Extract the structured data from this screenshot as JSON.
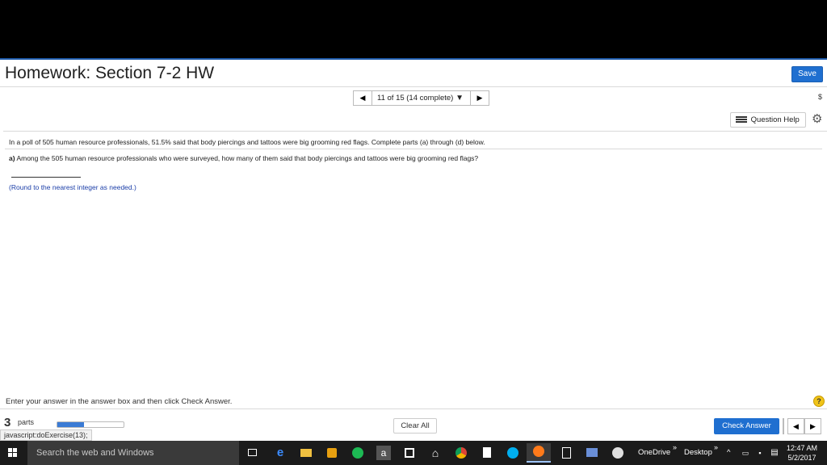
{
  "header": {
    "title": "Homework: Section 7-2 HW",
    "save_label": "Save"
  },
  "nav": {
    "prev": "◀",
    "counter": "11 of 15 (14 complete)",
    "caret": "▼",
    "next": "▶",
    "refresh": "$"
  },
  "tools": {
    "question_help": "Question Help",
    "gear": "⚙"
  },
  "question": {
    "prompt": "In a poll of 505 human resource professionals, 51.5% said that body piercings and tattoos were big grooming red flags. Complete parts (a) through (d) below.",
    "part_label": "a)",
    "part_text": " Among the 505 human resource professionals who were surveyed, how many of them said that body piercings and tattoos were big grooming red flags?",
    "answer_value": "",
    "round_hint": "(Round to the nearest integer as needed.)"
  },
  "footer": {
    "instructions": "Enter your answer in the answer box and then click Check Answer.",
    "help_glyph": "?",
    "parts_number": "3",
    "parts_label": "parts",
    "parts_progress": 0.4,
    "status_url": "javascript:doExercise(13);",
    "clear_all": "Clear All",
    "check_answer": "Check Answer",
    "prev": "◀",
    "next": "▶"
  },
  "taskbar": {
    "search_placeholder": "Search the web and Windows",
    "onedrive": "OneDrive",
    "desktop": "Desktop",
    "chevron": "»",
    "tray_up": "^",
    "time": "12:47 AM",
    "date": "5/2/2017",
    "store_letter": "a"
  },
  "colors": {
    "accent": "#1f6fd0",
    "hint": "#1b3ea8",
    "taskbar": "#1b1b1b"
  }
}
